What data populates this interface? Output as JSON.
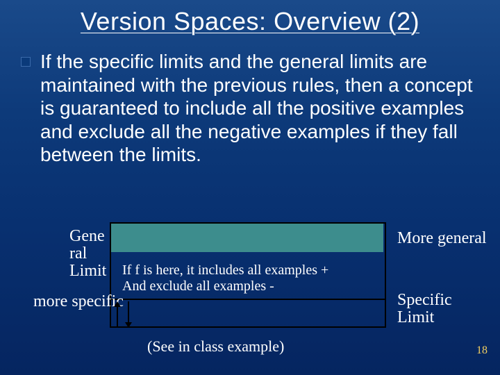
{
  "title": "Version Spaces: Overview (2)",
  "bullet": "If the specific limits and the general limits are maintained with the previous rules, then a concept is guaranteed to include all the positive examples and exclude all the negative examples if they fall between the limits.",
  "diagram": {
    "gen_label": "Gene ral Limit",
    "more_specific": "more specific",
    "more_general": "More general",
    "specific_limit": "Specific Limit",
    "mid_text_line1": "If f is here, it includes all examples +",
    "mid_text_line2": "And exclude all examples -",
    "see_example": "(See in class example)"
  },
  "page_number": "18"
}
